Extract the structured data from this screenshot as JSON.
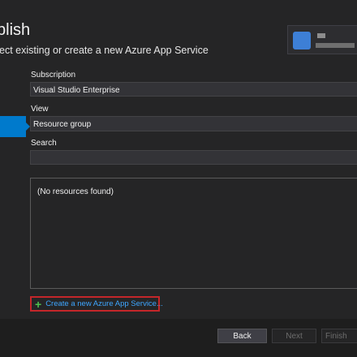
{
  "header": {
    "title": "blish",
    "subtitle": "ect existing or create a new Azure App Service"
  },
  "form": {
    "subscription_label": "Subscription",
    "subscription_value": "Visual Studio Enterprise",
    "view_label": "View",
    "view_value": "Resource group",
    "search_label": "Search",
    "search_value": ""
  },
  "results": {
    "empty_text": "(No resources found)"
  },
  "create_link": {
    "label": "Create a new Azure App Service..."
  },
  "footer": {
    "back": "Back",
    "next": "Next",
    "finish": "Finish"
  },
  "colors": {
    "accent": "#007acc",
    "link": "#3ea6ff",
    "highlight_border": "#c4262a",
    "plus": "#4ec24e"
  }
}
